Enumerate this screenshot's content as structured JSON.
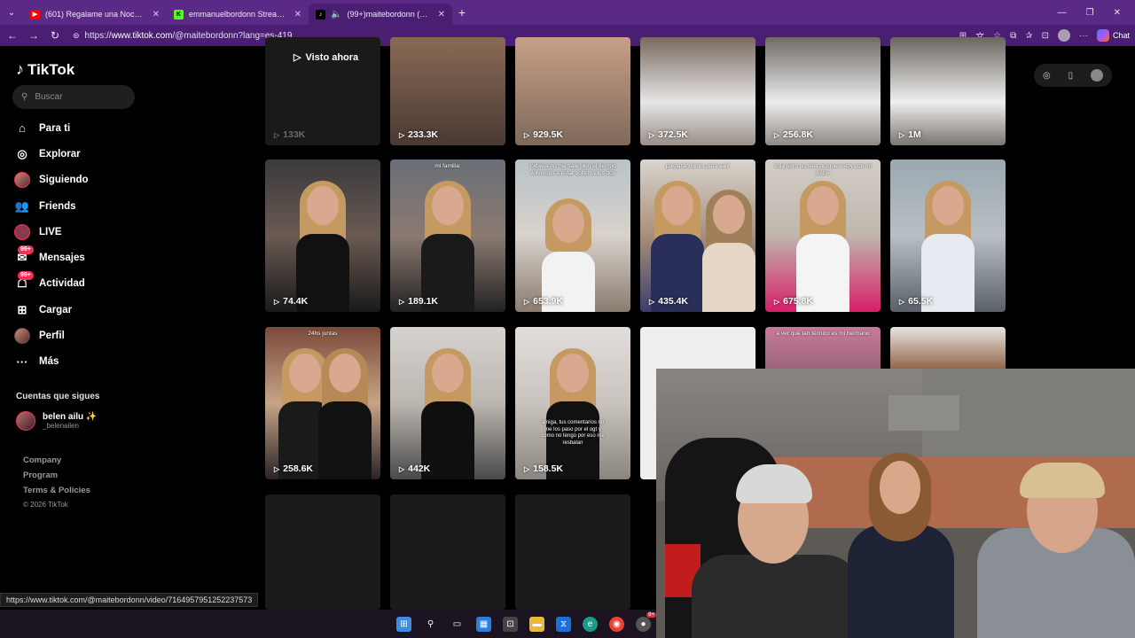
{
  "browser": {
    "tabs": [
      {
        "title": "(601) Regalame una Noche - YouT",
        "favicon": "youtube-icon",
        "color": "#ff0000"
      },
      {
        "title": "emmanuelbordonn Stream - Watc",
        "favicon": "kick-icon",
        "color": "#53fc18"
      },
      {
        "title": "(99+)maitebordonn (@maite",
        "favicon": "tiktok-icon",
        "color": "#000000"
      }
    ],
    "url_prefix": "https://",
    "url_host": "www.tiktok.com",
    "url_path": "/@maitebordonn?lang=es-419",
    "chat_label": "Chat"
  },
  "tiktok": {
    "brand": "TikTok",
    "search_placeholder": "Buscar",
    "nav": [
      {
        "label": "Para ti",
        "icon": "home-icon"
      },
      {
        "label": "Explorar",
        "icon": "compass-icon"
      },
      {
        "label": "Siguiendo",
        "icon": "avatar-icon"
      },
      {
        "label": "Friends",
        "icon": "friends-icon"
      },
      {
        "label": "LIVE",
        "icon": "live-icon"
      },
      {
        "label": "Mensajes",
        "icon": "messages-icon",
        "badge": "99+"
      },
      {
        "label": "Actividad",
        "icon": "activity-icon",
        "badge": "99+"
      },
      {
        "label": "Cargar",
        "icon": "upload-icon"
      },
      {
        "label": "Perfil",
        "icon": "profile-icon"
      },
      {
        "label": "Más",
        "icon": "more-icon"
      }
    ],
    "following_title": "Cuentas que sigues",
    "following": [
      {
        "name": "belen ailu ✨",
        "handle": "_belenailen"
      }
    ],
    "footer": [
      "Company",
      "Program",
      "Terms & Policies"
    ],
    "copyright": "© 2026 TikTok",
    "seen_label": "Visto ahora",
    "videos_row1": [
      "133K",
      "233.3K",
      "929.5K",
      "372.5K",
      "256.8K",
      "1M"
    ],
    "videos_row2": [
      {
        "views": "74.4K",
        "caption": ""
      },
      {
        "views": "189.1K",
        "caption": "mi familia:"
      },
      {
        "views": "653.9K",
        "caption": "todavía no me sale bien el tiempo volvemos a estar solteros los dos"
      },
      {
        "views": "435.4K",
        "caption": "preparándonos para salir"
      },
      {
        "views": "675.8K",
        "caption": "sola pero no sola porque estoy con mi bebe"
      },
      {
        "views": "65.5K",
        "caption": ""
      }
    ],
    "videos_row3": [
      {
        "views": "258.6K",
        "caption": "24hs juntas"
      },
      {
        "views": "442K",
        "caption": ""
      },
      {
        "views": "158.5K",
        "caption": "amiga, tus comentarios no me los paso por el ogt y como no tengo por eso me resbalan"
      }
    ],
    "row3_partial_caption": "a ver qué tan técnico es mi hermano"
  },
  "status_url": "https://www.tiktok.com/@maitebordonn/video/7164957951252237573",
  "taskbar": {
    "icons": [
      "windows-start-icon",
      "search-icon",
      "task-view-icon",
      "widgets-icon",
      "store-icon",
      "file-explorer-icon",
      "vpn-icon",
      "edge-icon",
      "chrome-icon",
      "app-icon"
    ],
    "badge": "9+"
  }
}
